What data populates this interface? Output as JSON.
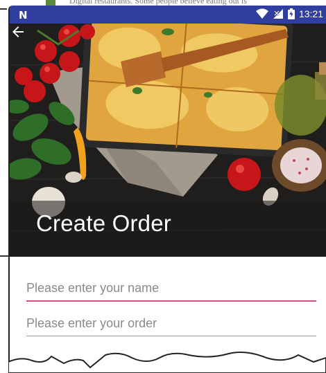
{
  "background_text": "Digital restaurants. Some people believe eating out is",
  "status_bar": {
    "notification_icon": "n-icon",
    "time": "13:21",
    "icons": [
      "wifi-icon",
      "signal-icon",
      "battery-icon"
    ]
  },
  "header": {
    "back_icon": "back-arrow-icon",
    "title": "Create Order"
  },
  "form": {
    "name_placeholder": "Please enter your name",
    "name_value": "",
    "order_placeholder": "Please enter your order",
    "order_value": ""
  },
  "colors": {
    "status_bar": "#303f9f",
    "accent": "#e0467a",
    "hero_background": "#1d1c1b"
  }
}
